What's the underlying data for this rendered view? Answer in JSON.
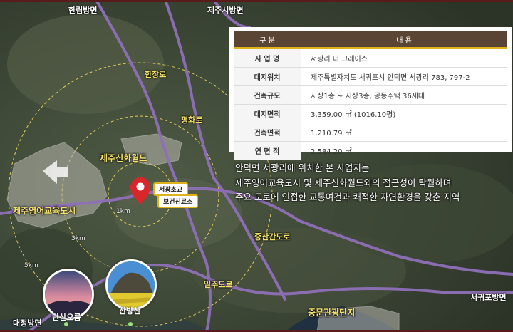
{
  "roads": {
    "hallim": "한림방면",
    "jeju_city": "제주시방면",
    "hanchang": "한창로",
    "pyeonghwa": "평화로",
    "jungsangan": "중산간도로",
    "ilju": "일주도로",
    "seogwipo": "서귀포방면",
    "daejeong": "대정방면"
  },
  "areas": {
    "shinhwa": "제주신화월드",
    "education": "제주영어교육도시",
    "jungmun": "중문관광단지"
  },
  "distance": {
    "d1": "1km",
    "d3": "3km",
    "d5": "5km"
  },
  "poi": {
    "school": "서광초교",
    "clinic": "보건진료소"
  },
  "spots": {
    "dansan": "단산오름",
    "sanbang": "산방산"
  },
  "table": {
    "header": {
      "col1": "구 분",
      "col2": "내 용"
    },
    "rows": [
      {
        "label": "사 업 명",
        "value": "서광리 더 그레이스"
      },
      {
        "label": "대지위치",
        "value": "제주특별자치도 서귀포시 안덕면 서광리 783, 797-2"
      },
      {
        "label": "건축규모",
        "value": "지상1층 ~ 지상3층, 공동주택 36세대"
      },
      {
        "label": "대지면적",
        "value": "3,359.00 ㎡ (1016.10평)"
      },
      {
        "label": "건축면적",
        "value": "1,210.79 ㎡"
      },
      {
        "label": "연 면 적",
        "value": "2,584.20 ㎡"
      }
    ]
  },
  "description": {
    "line1": "안덕면 서광리에 위치한 본 사업지는",
    "line2": "제주영어교육도시 및 제주신화월드와의 접근성이 탁월하며",
    "line3": "주요 도로에 인접한 교통여건과 쾌적한 자연환경을 갖춘 지역"
  },
  "colors": {
    "accent": "#e0b21a",
    "header": "#5a4433",
    "marker": "#d9262a",
    "stripe": "#5a1b1b"
  }
}
